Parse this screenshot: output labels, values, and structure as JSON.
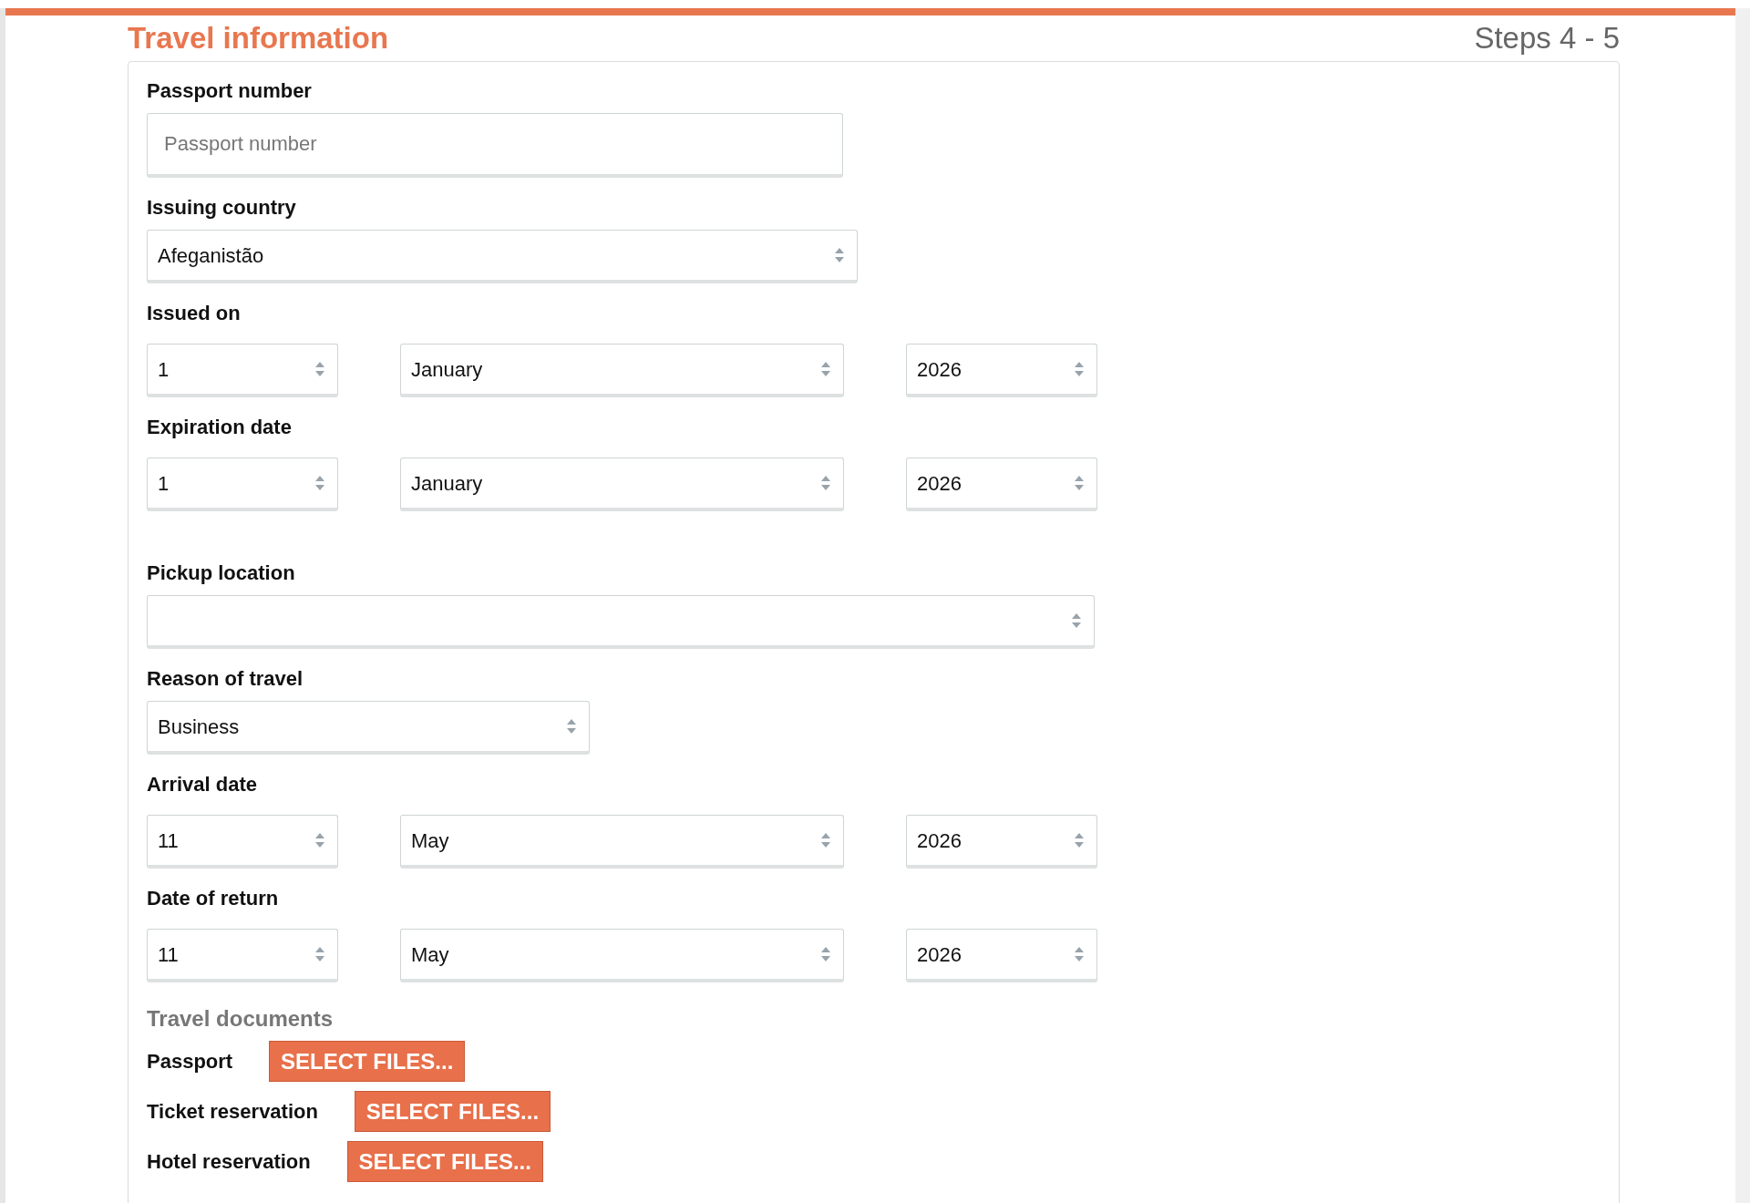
{
  "header": {
    "title": "Travel information",
    "steps": "Steps 4 - 5"
  },
  "passport_fields": [
    {
      "kind": "text",
      "label": "Passport number",
      "placeholder": "Passport number"
    },
    {
      "kind": "select",
      "label": "Issuing country",
      "value": "Afeganistão"
    },
    {
      "kind": "date",
      "label": "Issued on",
      "day": "1",
      "month": "January",
      "year": "2026"
    },
    {
      "kind": "date",
      "label": "Expiration date",
      "day": "1",
      "month": "January",
      "year": "2026"
    }
  ],
  "travel_fields": [
    {
      "kind": "select",
      "label": "Pickup location"
    },
    {
      "kind": "select",
      "label": "Reason of travel",
      "value": "Business"
    },
    {
      "kind": "date",
      "label": "Arrival date",
      "day": "11",
      "month": "May",
      "year": "2026"
    },
    {
      "kind": "date",
      "label": "Date of return",
      "day": "11",
      "month": "May",
      "year": "2026"
    }
  ],
  "documents": {
    "title": "Travel documents",
    "items": [
      {
        "label": "Passport",
        "button": "SELECT FILES..."
      },
      {
        "label": "Ticket reservation",
        "button": "SELECT FILES..."
      },
      {
        "label": "Hotel reservation",
        "button": "SELECT FILES..."
      }
    ]
  }
}
